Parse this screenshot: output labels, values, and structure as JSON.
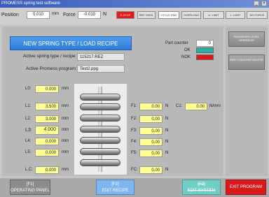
{
  "title": "PROMESS spring test software",
  "position": {
    "label": "Position",
    "value": "0.010",
    "unit": "mm"
  },
  "force": {
    "label": "Force",
    "value": "-0.010",
    "unit": "N"
  },
  "indicators": [
    "E-STOP",
    "REF. MISS.",
    "CYCLE END",
    "OVERLOAD",
    "U. LIMIT",
    "L. LIMIT",
    "NO FORCE"
  ],
  "new_type_button": "NEW SPRING TYPE / LOAD RECIPE",
  "spring_type_label": "Active spring type / recipe:",
  "spring_type_value": "115217.REZ",
  "program_label": "Active Promess program:",
  "program_value": "Test2.ppg",
  "part_counter": {
    "label": "Part counter",
    "value": "0"
  },
  "ok_label": "OK",
  "nok_label": "NOK",
  "password_button": "PASSWORD LEVEL OPERATOR",
  "counter_reset_button": "PART COUNTER DELETE",
  "lengths": [
    {
      "label": "L0:",
      "value": "0.000",
      "unit": "mm"
    },
    {
      "label": "L1:",
      "value": "3.500",
      "unit": "mm"
    },
    {
      "label": "L2:",
      "value": "3.000",
      "unit": "mm"
    },
    {
      "label": "L3:",
      "value": "4.000",
      "unit": "mm"
    },
    {
      "label": "L4:",
      "value": "0.000",
      "unit": "mm"
    },
    {
      "label": "L5:",
      "value": "0.000",
      "unit": "mm"
    },
    {
      "label": "L.C:",
      "value": "0.000",
      "unit": "mm"
    }
  ],
  "forces": [
    {
      "label": "F1:",
      "value": "0.00",
      "unit": "N"
    },
    {
      "label": "F2:",
      "value": "0.00",
      "unit": "N"
    },
    {
      "label": "F3:",
      "value": "0.00",
      "unit": "N"
    },
    {
      "label": "F4:",
      "value": "0.00",
      "unit": "N"
    },
    {
      "label": "F5:",
      "value": "0.00",
      "unit": "N"
    },
    {
      "label": "FC:",
      "value": "0.00",
      "unit": "N"
    }
  ],
  "c1": {
    "label": "C1:",
    "value": "0.00",
    "unit": "N/mm"
  },
  "footer": {
    "f1_key": "[F1]",
    "f1_label": "OPERATING PANEL",
    "f2_key": "[F2]",
    "f2_label": "EDIT RECIPE",
    "f3_key": "[F3]",
    "f3_label": "EDIT SYSTEM",
    "exit_label": "EXIT PROGRAM"
  },
  "colors": {
    "ok": "#1fb5a8",
    "nok": "#e01818",
    "estop": "#e31b1b",
    "accent": "#2f7ad6"
  }
}
